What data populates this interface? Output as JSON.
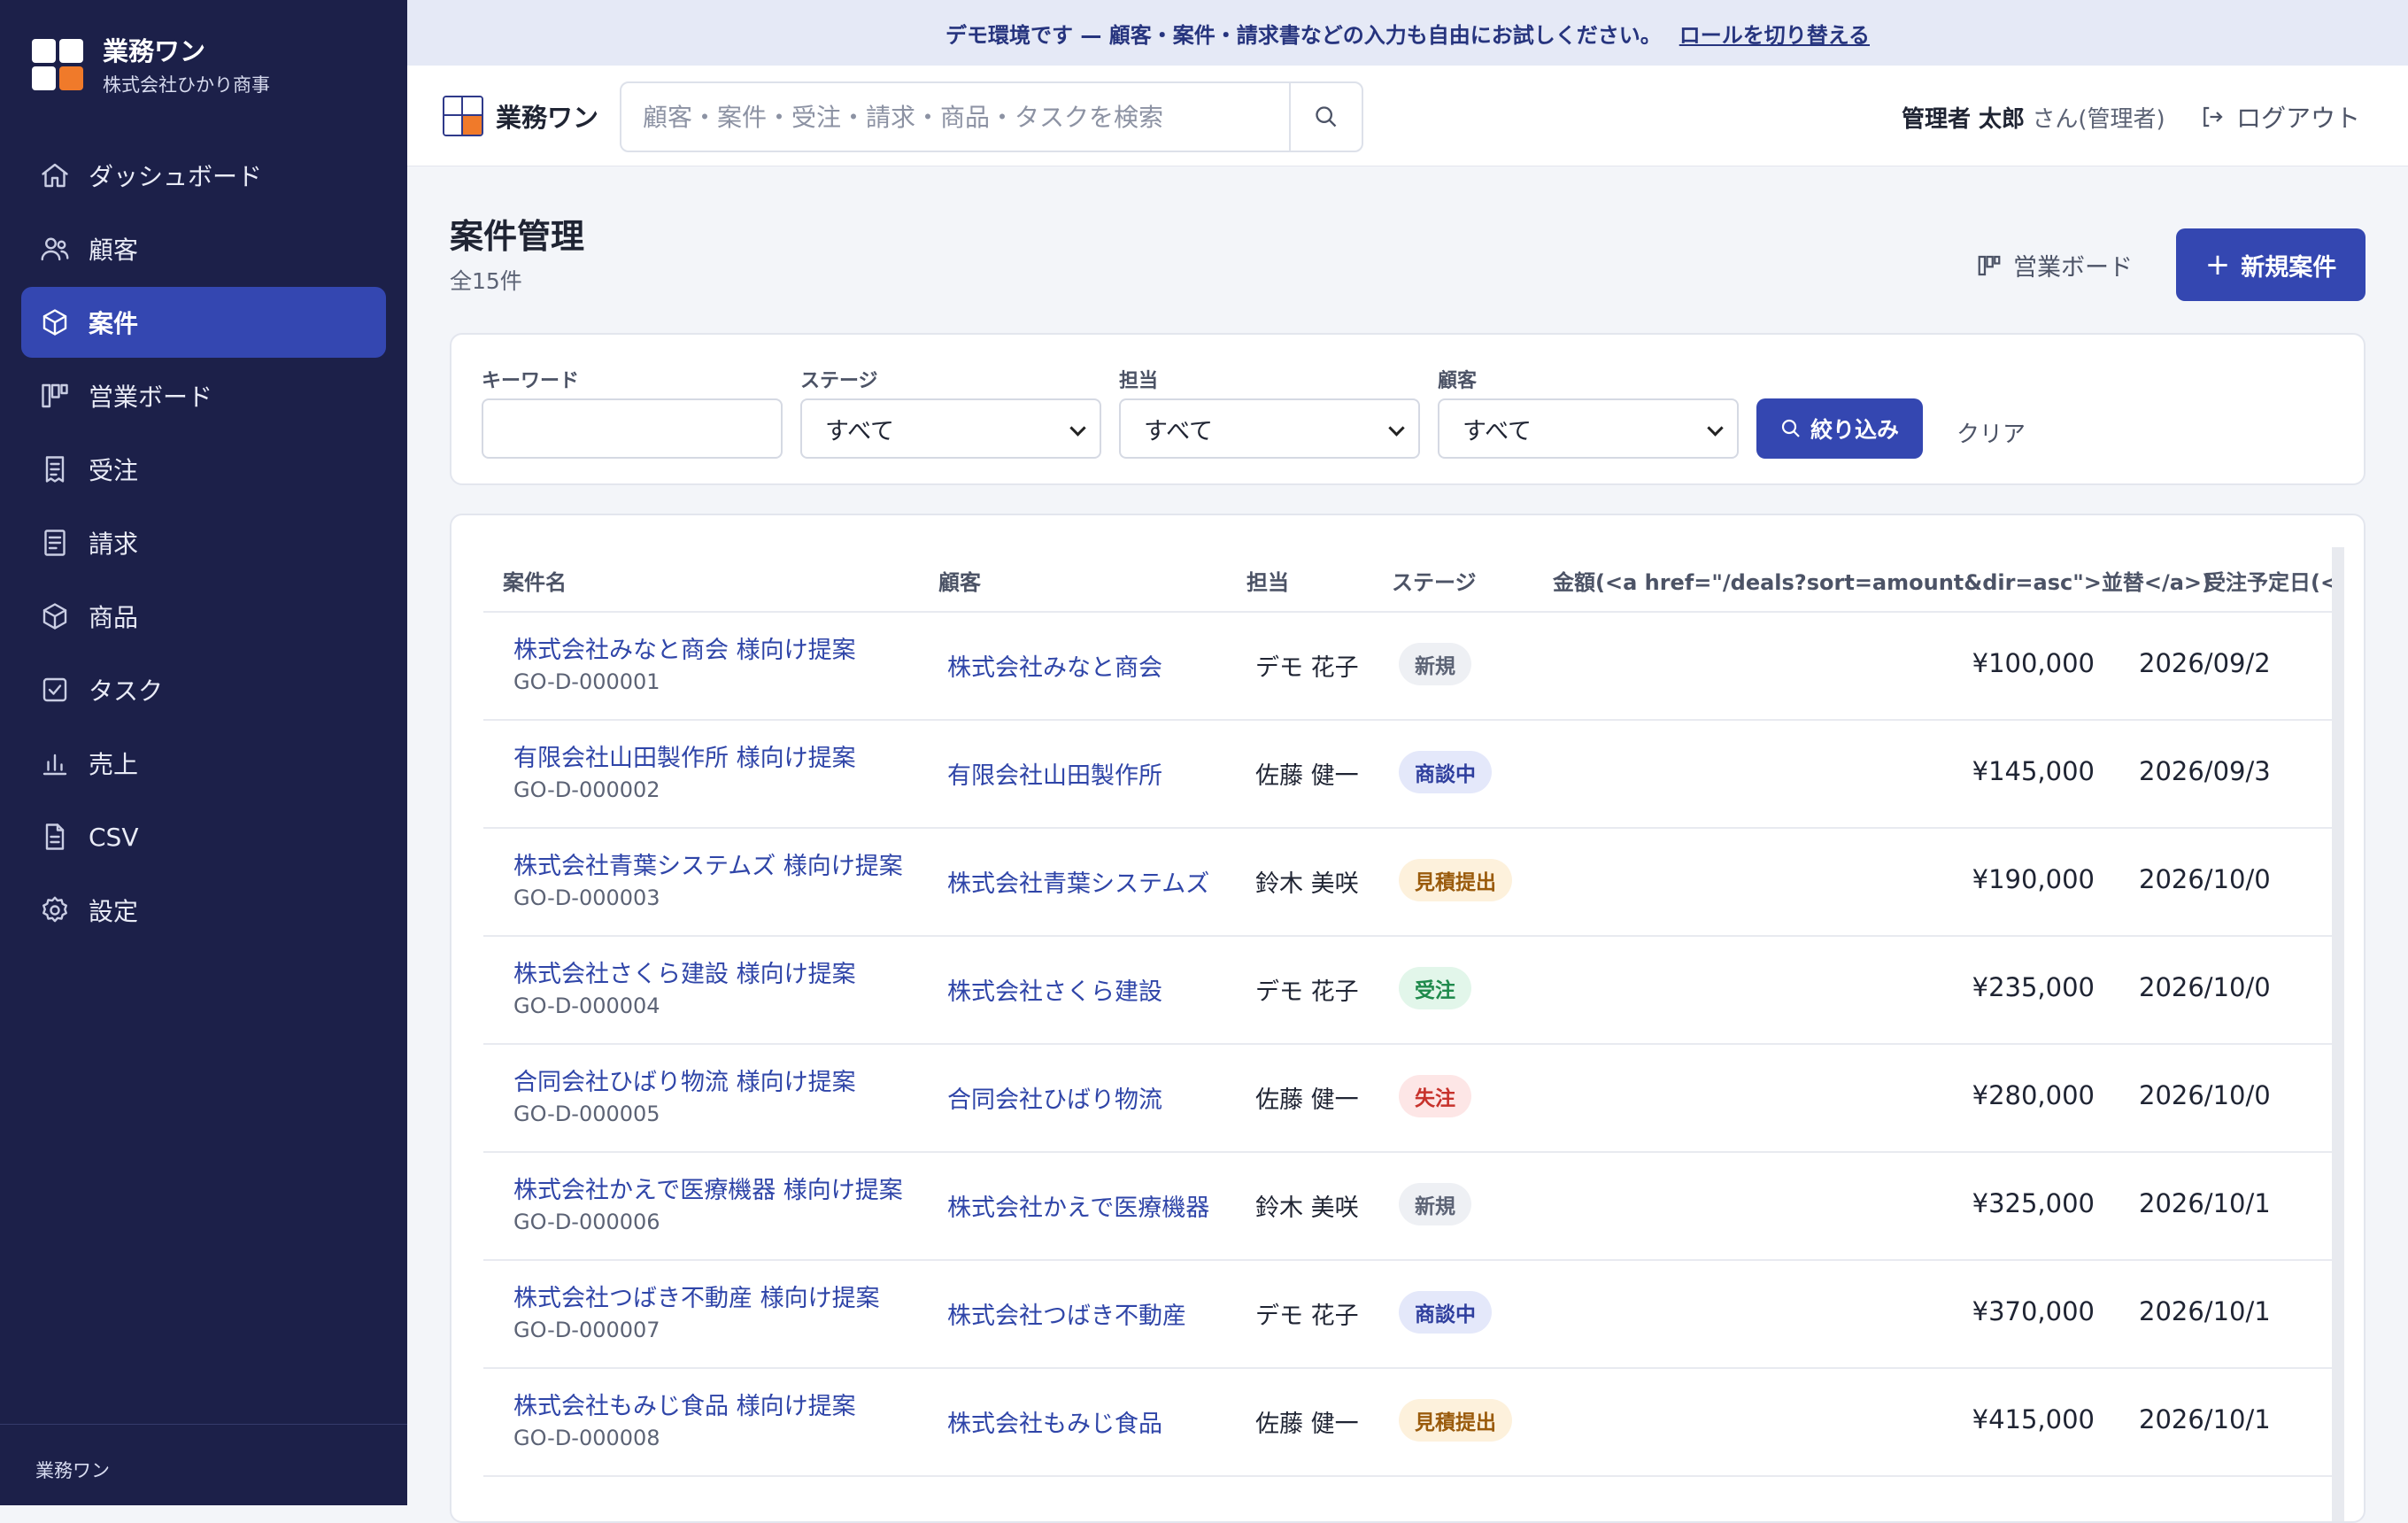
{
  "banner": {
    "message": "デモ環境です — 顧客・案件・請求書などの入力も自由にお試しください。",
    "link": "ロールを切り替える"
  },
  "sidebar": {
    "app_name": "業務ワン",
    "company": "株式会社ひかり商事",
    "items": [
      {
        "label": "ダッシュボード",
        "icon": "home-icon",
        "active": false
      },
      {
        "label": "顧客",
        "icon": "users-icon",
        "active": false
      },
      {
        "label": "案件",
        "icon": "cube-icon",
        "active": true
      },
      {
        "label": "営業ボード",
        "icon": "kanban-icon",
        "active": false
      },
      {
        "label": "受注",
        "icon": "receipt-icon",
        "active": false
      },
      {
        "label": "請求",
        "icon": "invoice-icon",
        "active": false
      },
      {
        "label": "商品",
        "icon": "box-icon",
        "active": false
      },
      {
        "label": "タスク",
        "icon": "checkbox-icon",
        "active": false
      },
      {
        "label": "売上",
        "icon": "bar-chart-icon",
        "active": false
      },
      {
        "label": "CSV",
        "icon": "file-icon",
        "active": false
      },
      {
        "label": "設定",
        "icon": "gear-icon",
        "active": false
      }
    ],
    "footer": "業務ワン"
  },
  "header": {
    "app_name": "業務ワン",
    "search_placeholder": "顧客・案件・受注・請求・商品・タスクを検索",
    "user_name": "管理者 太郎",
    "user_role": "さん(管理者)",
    "logout": "ログアウト"
  },
  "page": {
    "title": "案件管理",
    "count": "全15件",
    "board_link": "営業ボード",
    "new_button": "新規案件"
  },
  "filters": {
    "keyword_label": "キーワード",
    "keyword_value": "",
    "stage_label": "ステージ",
    "stage_value": "すべて",
    "owner_label": "担当",
    "owner_value": "すべて",
    "customer_label": "顧客",
    "customer_value": "すべて",
    "submit": "絞り込み",
    "clear": "クリア"
  },
  "table": {
    "columns": [
      "案件名",
      "顧客",
      "担当",
      "ステージ",
      "金額(<a href=\"/deals?sort=amount&dir=asc\">並替</a>)",
      "受注予定日(<"
    ],
    "rows": [
      {
        "name": "株式会社みなと商会 様向け提案",
        "code": "GO-D-000001",
        "customer": "株式会社みなと商会",
        "owner": "デモ 花子",
        "stage": "新規",
        "amount": "¥100,000",
        "date": "2026/09/2"
      },
      {
        "name": "有限会社山田製作所 様向け提案",
        "code": "GO-D-000002",
        "customer": "有限会社山田製作所",
        "owner": "佐藤 健一",
        "stage": "商談中",
        "amount": "¥145,000",
        "date": "2026/09/3"
      },
      {
        "name": "株式会社青葉システムズ 様向け提案",
        "code": "GO-D-000003",
        "customer": "株式会社青葉システムズ",
        "owner": "鈴木 美咲",
        "stage": "見積提出",
        "amount": "¥190,000",
        "date": "2026/10/0"
      },
      {
        "name": "株式会社さくら建設 様向け提案",
        "code": "GO-D-000004",
        "customer": "株式会社さくら建設",
        "owner": "デモ 花子",
        "stage": "受注",
        "amount": "¥235,000",
        "date": "2026/10/0"
      },
      {
        "name": "合同会社ひばり物流 様向け提案",
        "code": "GO-D-000005",
        "customer": "合同会社ひばり物流",
        "owner": "佐藤 健一",
        "stage": "失注",
        "amount": "¥280,000",
        "date": "2026/10/0"
      },
      {
        "name": "株式会社かえで医療機器 様向け提案",
        "code": "GO-D-000006",
        "customer": "株式会社かえで医療機器",
        "owner": "鈴木 美咲",
        "stage": "新規",
        "amount": "¥325,000",
        "date": "2026/10/1"
      },
      {
        "name": "株式会社つばき不動産 様向け提案",
        "code": "GO-D-000007",
        "customer": "株式会社つばき不動産",
        "owner": "デモ 花子",
        "stage": "商談中",
        "amount": "¥370,000",
        "date": "2026/10/1"
      },
      {
        "name": "株式会社もみじ食品 様向け提案",
        "code": "GO-D-000008",
        "customer": "株式会社もみじ食品",
        "owner": "佐藤 健一",
        "stage": "見積提出",
        "amount": "¥415,000",
        "date": "2026/10/1"
      }
    ]
  },
  "stage_colors": {
    "新規": {
      "bg": "#eef0f4",
      "fg": "#5c6375"
    },
    "商談中": {
      "bg": "#e4e8fa",
      "fg": "#2f3f9e"
    },
    "見積提出": {
      "bg": "#fdf1dc",
      "fg": "#9a5b0c"
    },
    "受注": {
      "bg": "#e2f6ea",
      "fg": "#1f8a4c"
    },
    "失注": {
      "bg": "#fde6e6",
      "fg": "#c7322c"
    }
  },
  "colors": {
    "sidebar_bg": "#1c2049",
    "accent": "#3447b1",
    "brand_orange": "#f07a2a",
    "link": "#2f45a8"
  }
}
